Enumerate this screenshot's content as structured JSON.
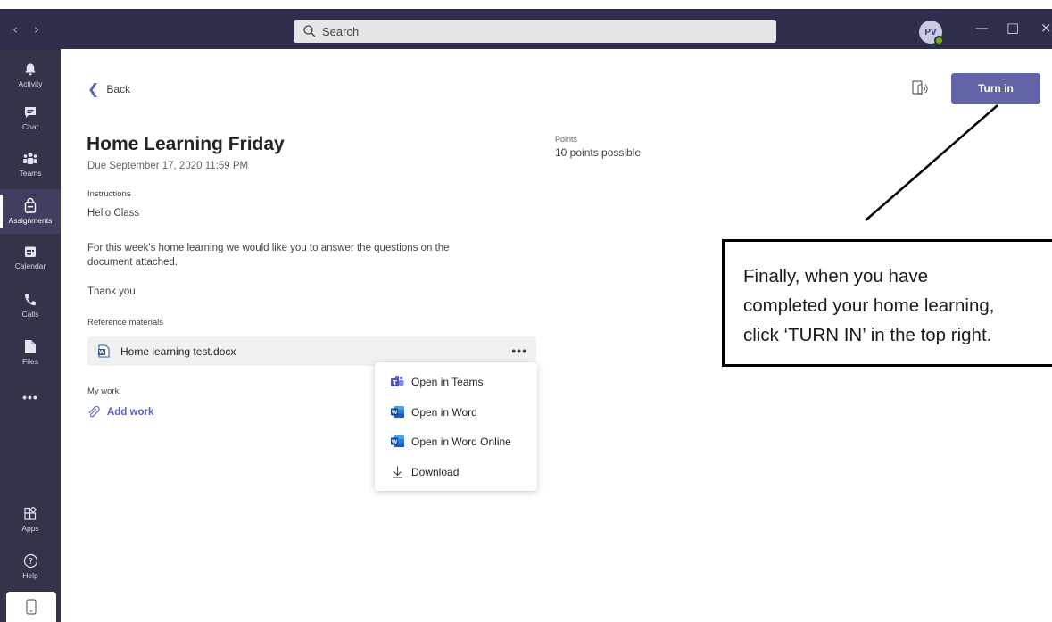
{
  "titlebar": {
    "search_placeholder": "Search",
    "avatar_initials": "PV",
    "minimize": "—",
    "maximize": "□",
    "close": "×"
  },
  "rail": {
    "items": [
      {
        "label": "Activity",
        "icon": "bell-icon"
      },
      {
        "label": "Chat",
        "icon": "chat-icon"
      },
      {
        "label": "Teams",
        "icon": "teams-icon"
      },
      {
        "label": "Assignments",
        "icon": "assignments-icon"
      },
      {
        "label": "Calendar",
        "icon": "calendar-icon"
      },
      {
        "label": "Calls",
        "icon": "phone-icon"
      },
      {
        "label": "Files",
        "icon": "file-icon"
      },
      {
        "label": "•••",
        "icon": "more-icon"
      },
      {
        "label": "Apps",
        "icon": "apps-icon"
      },
      {
        "label": "Help",
        "icon": "help-icon"
      }
    ]
  },
  "assignment": {
    "back_label": "Back",
    "turn_in_label": "Turn in",
    "title": "Home Learning Friday",
    "due": "Due September 17, 2020 11:59 PM",
    "points_label": "Points",
    "points_value": "10 points possible",
    "instructions_label": "Instructions",
    "instructions_lines": [
      "Hello Class",
      "For this week's home learning we would like you to answer the questions on the",
      "document attached.",
      "Thank you"
    ],
    "reference_label": "Reference materials",
    "reference_file": "Home learning test.docx",
    "more_label": "•••",
    "my_work_label": "My work",
    "add_work_label": "Add work"
  },
  "context_menu": {
    "items": [
      {
        "label": "Open in Teams",
        "icon": "teams-icon"
      },
      {
        "label": "Open in Word",
        "icon": "word-icon"
      },
      {
        "label": "Open in Word Online",
        "icon": "word-icon"
      },
      {
        "label": "Download",
        "icon": "download-icon"
      }
    ]
  },
  "annotation": {
    "lines": [
      "Finally, when you have",
      "completed your home learning,",
      "click ‘TURN IN’ in the top right."
    ]
  },
  "colors": {
    "titlebar": "#2f2f4d",
    "rail": "#33344a",
    "accent": "#6264a7",
    "link": "#5b5fc7",
    "presence": "#6bb700"
  }
}
